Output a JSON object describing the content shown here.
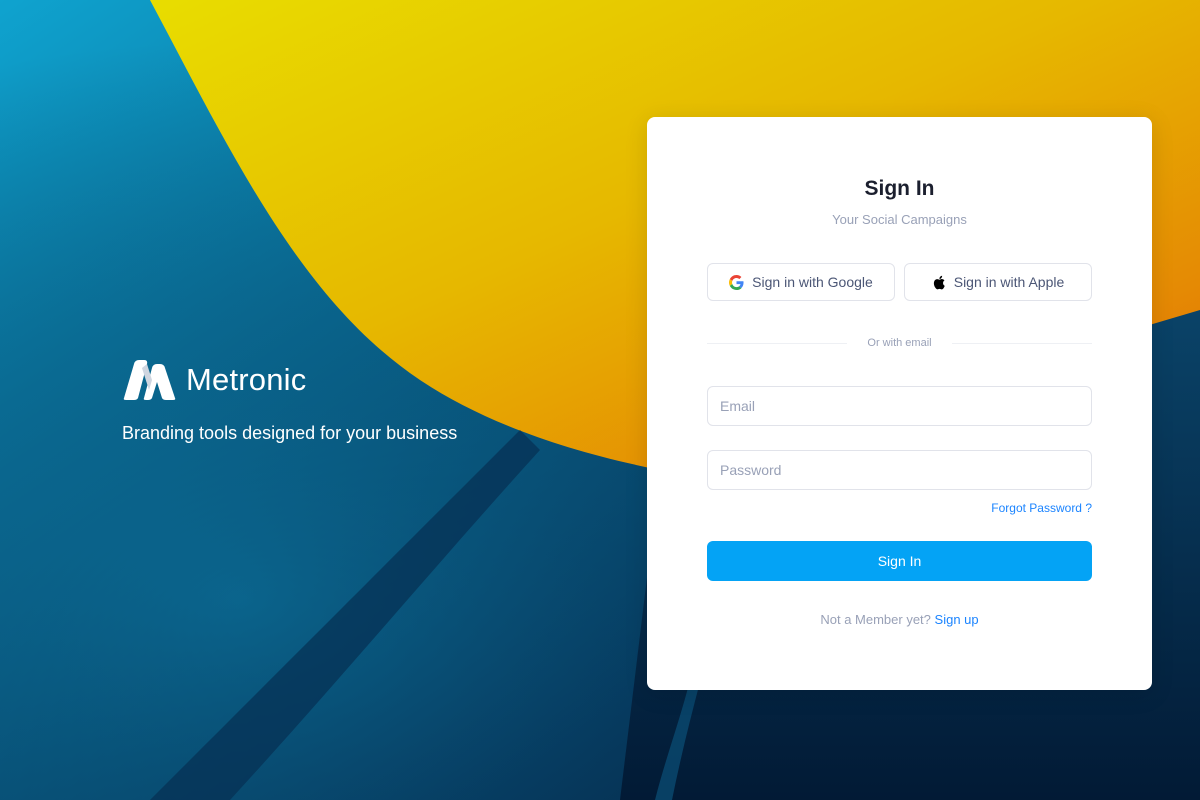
{
  "colors": {
    "accent": "#04A3F5",
    "link": "#1B84FF",
    "background_blue": "#0A5E87",
    "background_yellow": "#E8D400",
    "background_orange": "#E56A05"
  },
  "brand": {
    "logo_icon": "metronic-logo-icon",
    "name": "Metronic",
    "tagline": "Branding tools designed for your business"
  },
  "signin": {
    "title": "Sign In",
    "subtitle": "Your Social Campaigns",
    "google_button": {
      "icon": "google-icon",
      "label": "Sign in with Google"
    },
    "apple_button": {
      "icon": "apple-icon",
      "label": "Sign in with Apple"
    },
    "divider_text": "Or with email",
    "email": {
      "value": "",
      "placeholder": "Email"
    },
    "password": {
      "value": "",
      "placeholder": "Password"
    },
    "forgot_link": "Forgot Password ?",
    "submit_label": "Sign In",
    "signup_prompt": "Not a Member yet?",
    "signup_link": "Sign up"
  }
}
